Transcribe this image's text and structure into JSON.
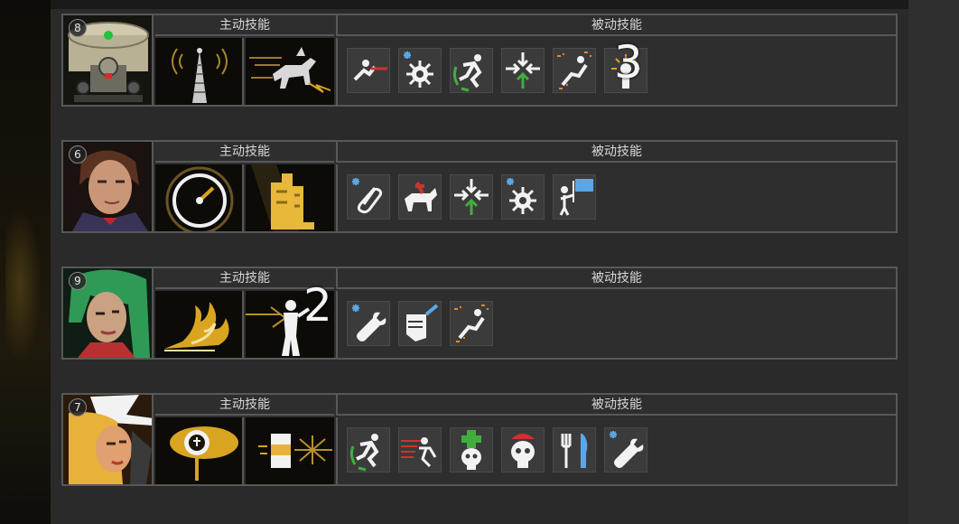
{
  "headers": {
    "active": "主动技能",
    "passive": "被动技能"
  },
  "characters": [
    {
      "level": "8",
      "portrait": "armored-mech-pilot-icon",
      "active_skills": [
        "radio-tower-icon",
        "charging-horse-icon"
      ],
      "passive_skills": [
        "lunge-strike-icon",
        "gear-burst-icon",
        "dodge-run-icon",
        "converge-arrows-up-icon",
        "sprint-sparks-icon",
        "sun-figure-icon"
      ],
      "overlay_number": "3"
    },
    {
      "level": "6",
      "portrait": "man-in-suit-icon",
      "active_skills": [
        "speedometer-icon",
        "golden-building-icon"
      ],
      "passive_skills": [
        "paperclip-icon",
        "horse-rider-icon",
        "converge-arrows-up-icon",
        "gear-burst-icon",
        "flag-bearer-icon"
      ],
      "overlay_number": ""
    },
    {
      "level": "9",
      "portrait": "green-haired-woman-icon",
      "active_skills": [
        "flame-swirl-icon",
        "glowing-figure-icon"
      ],
      "passive_skills": [
        "wrench-icon",
        "fist-punch-icon",
        "sprint-sparks-icon"
      ],
      "overlay_number": "2"
    },
    {
      "level": "7",
      "portrait": "witch-hat-woman-icon",
      "active_skills": [
        "target-sign-icon",
        "glowing-canister-icon"
      ],
      "passive_skills": [
        "dodge-run-icon",
        "dash-runner-icon",
        "medic-skull-icon",
        "capped-skull-icon",
        "fork-knife-icon",
        "wrench-icon"
      ],
      "overlay_number": ""
    }
  ],
  "colors": {
    "panel_border": "#585858",
    "icon_tile": "#3b3b3b",
    "gold": "#d9a520",
    "ice_blue": "#5aa7e8",
    "green": "#3fae3f",
    "red": "#d23030"
  }
}
